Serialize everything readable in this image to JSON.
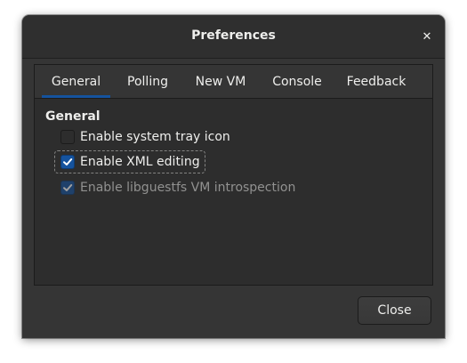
{
  "window": {
    "title": "Preferences",
    "close_glyph": "✕"
  },
  "tabs": [
    {
      "label": "General",
      "active": true
    },
    {
      "label": "Polling",
      "active": false
    },
    {
      "label": "New VM",
      "active": false
    },
    {
      "label": "Console",
      "active": false
    },
    {
      "label": "Feedback",
      "active": false
    }
  ],
  "general": {
    "section_title": "General",
    "options": [
      {
        "label": "Enable system tray icon",
        "checked": false,
        "enabled": true
      },
      {
        "label": "Enable XML editing",
        "checked": true,
        "enabled": true
      },
      {
        "label": "Enable libguestfs VM introspection",
        "checked": true,
        "enabled": false
      }
    ]
  },
  "footer": {
    "close_label": "Close"
  },
  "colors": {
    "accent": "#15539e",
    "window_bg": "#353535",
    "text": "#eeeeec",
    "disabled_text": "#919190"
  }
}
